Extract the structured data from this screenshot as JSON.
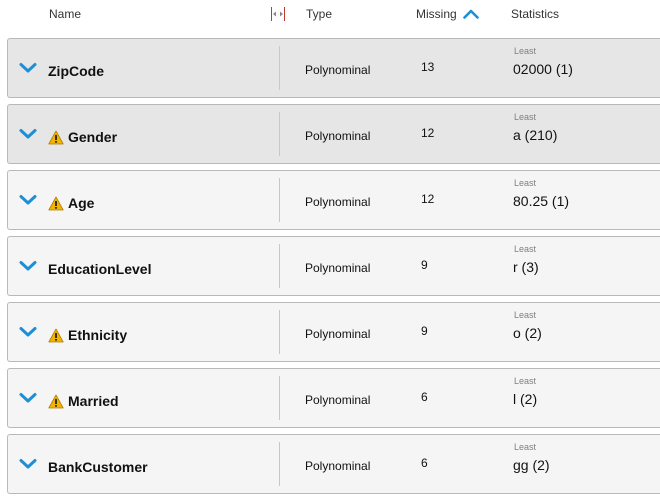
{
  "header": {
    "name": "Name",
    "type": "Type",
    "missing": "Missing",
    "statistics": "Statistics"
  },
  "colors": {
    "chevron": "#1e8fd6",
    "warning": "#f2b400",
    "row_background": "#f5f5f5",
    "row_selected": "#e6e6e6"
  },
  "icons": {
    "expand": "chevron-down-icon",
    "warning": "warning-icon",
    "sort": "sort-ascending-icon",
    "resize": "column-resize-icon"
  },
  "rows": [
    {
      "name": "ZipCode",
      "warning": false,
      "type": "Polynominal",
      "missing": "13",
      "stat_label": "Least",
      "stat_value": "02000 (1)",
      "selected": true
    },
    {
      "name": "Gender",
      "warning": true,
      "type": "Polynominal",
      "missing": "12",
      "stat_label": "Least",
      "stat_value": "a (210)",
      "selected": true
    },
    {
      "name": "Age",
      "warning": true,
      "type": "Polynominal",
      "missing": "12",
      "stat_label": "Least",
      "stat_value": "80.25 (1)",
      "selected": false
    },
    {
      "name": "EducationLevel",
      "warning": false,
      "type": "Polynominal",
      "missing": "9",
      "stat_label": "Least",
      "stat_value": "r (3)",
      "selected": false
    },
    {
      "name": "Ethnicity",
      "warning": true,
      "type": "Polynominal",
      "missing": "9",
      "stat_label": "Least",
      "stat_value": "o (2)",
      "selected": false
    },
    {
      "name": "Married",
      "warning": true,
      "type": "Polynominal",
      "missing": "6",
      "stat_label": "Least",
      "stat_value": "l (2)",
      "selected": false
    },
    {
      "name": "BankCustomer",
      "warning": false,
      "type": "Polynominal",
      "missing": "6",
      "stat_label": "Least",
      "stat_value": "gg (2)",
      "selected": false
    }
  ]
}
